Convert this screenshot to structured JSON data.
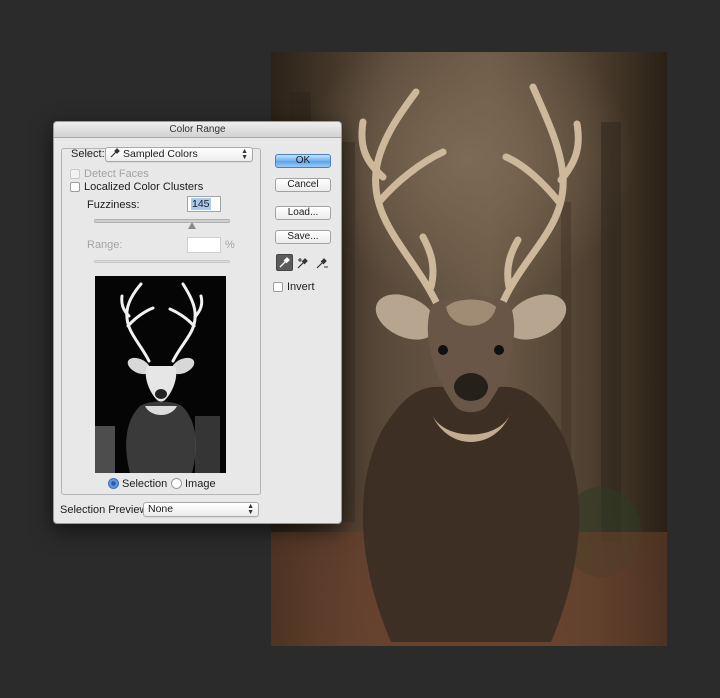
{
  "dialog": {
    "title": "Color Range",
    "select_label": "Select:",
    "select_value": "Sampled Colors",
    "detect_faces_label": "Detect Faces",
    "localized_clusters_label": "Localized Color Clusters",
    "fuzziness_label": "Fuzziness:",
    "fuzziness_value": "145",
    "range_label": "Range:",
    "range_value": "",
    "range_unit": "%",
    "view_selection_label": "Selection",
    "view_image_label": "Image",
    "selection_preview_label": "Selection Preview:",
    "selection_preview_value": "None",
    "ok_label": "OK",
    "cancel_label": "Cancel",
    "load_label": "Load...",
    "save_label": "Save...",
    "invert_label": "Invert"
  },
  "colors": {
    "workspace_bg": "#2b2b2b",
    "dialog_bg": "#e8e8e8",
    "ok_accent": "#6eb1f0"
  },
  "icons": {
    "select_icon": "eyedropper-icon",
    "tools": [
      "eyedropper-icon",
      "eyedropper-plus-icon",
      "eyedropper-minus-icon"
    ]
  }
}
